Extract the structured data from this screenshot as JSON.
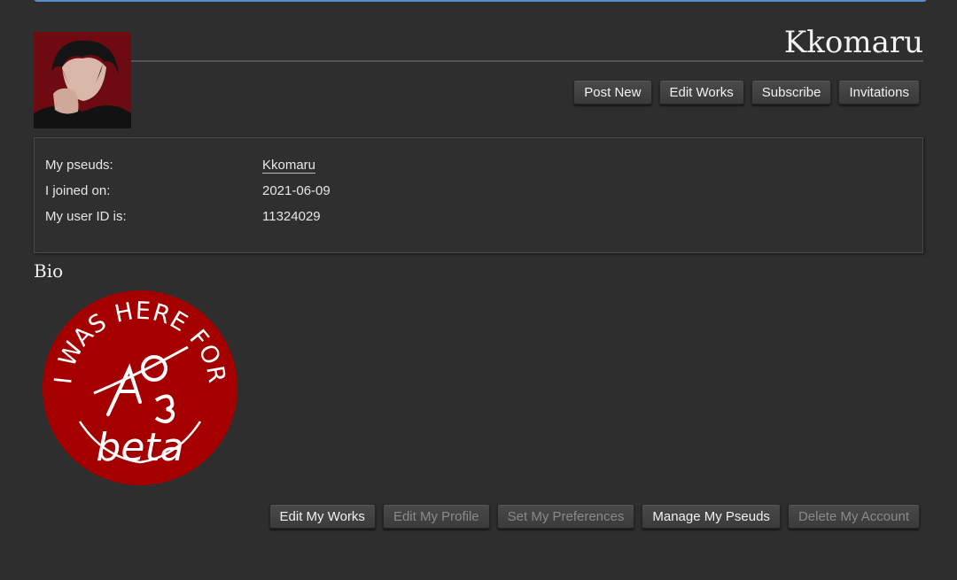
{
  "user": {
    "name": "Kkomaru",
    "avatar_alt": "user avatar"
  },
  "top_actions": [
    {
      "label": "Post New"
    },
    {
      "label": "Edit Works"
    },
    {
      "label": "Subscribe"
    },
    {
      "label": "Invitations"
    }
  ],
  "meta": {
    "pseuds_label": "My pseuds:",
    "pseuds_value": "Kkomaru",
    "joined_label": "I joined on:",
    "joined_value": "2021-06-09",
    "userid_label": "My user ID is:",
    "userid_value": "11324029"
  },
  "bio": {
    "heading": "Bio",
    "badge_text_top": "I WAS HERE FOR",
    "badge_text_bottom": "beta"
  },
  "bottom_actions": [
    {
      "label": "Edit My Works",
      "enabled": true
    },
    {
      "label": "Edit My Profile",
      "enabled": false
    },
    {
      "label": "Set My Preferences",
      "enabled": false
    },
    {
      "label": "Manage My Pseuds",
      "enabled": true
    },
    {
      "label": "Delete My Account",
      "enabled": false
    }
  ],
  "colors": {
    "background": "#2e2e2e",
    "accent_border": "#5a8ec7",
    "badge_red": "#a50000"
  }
}
